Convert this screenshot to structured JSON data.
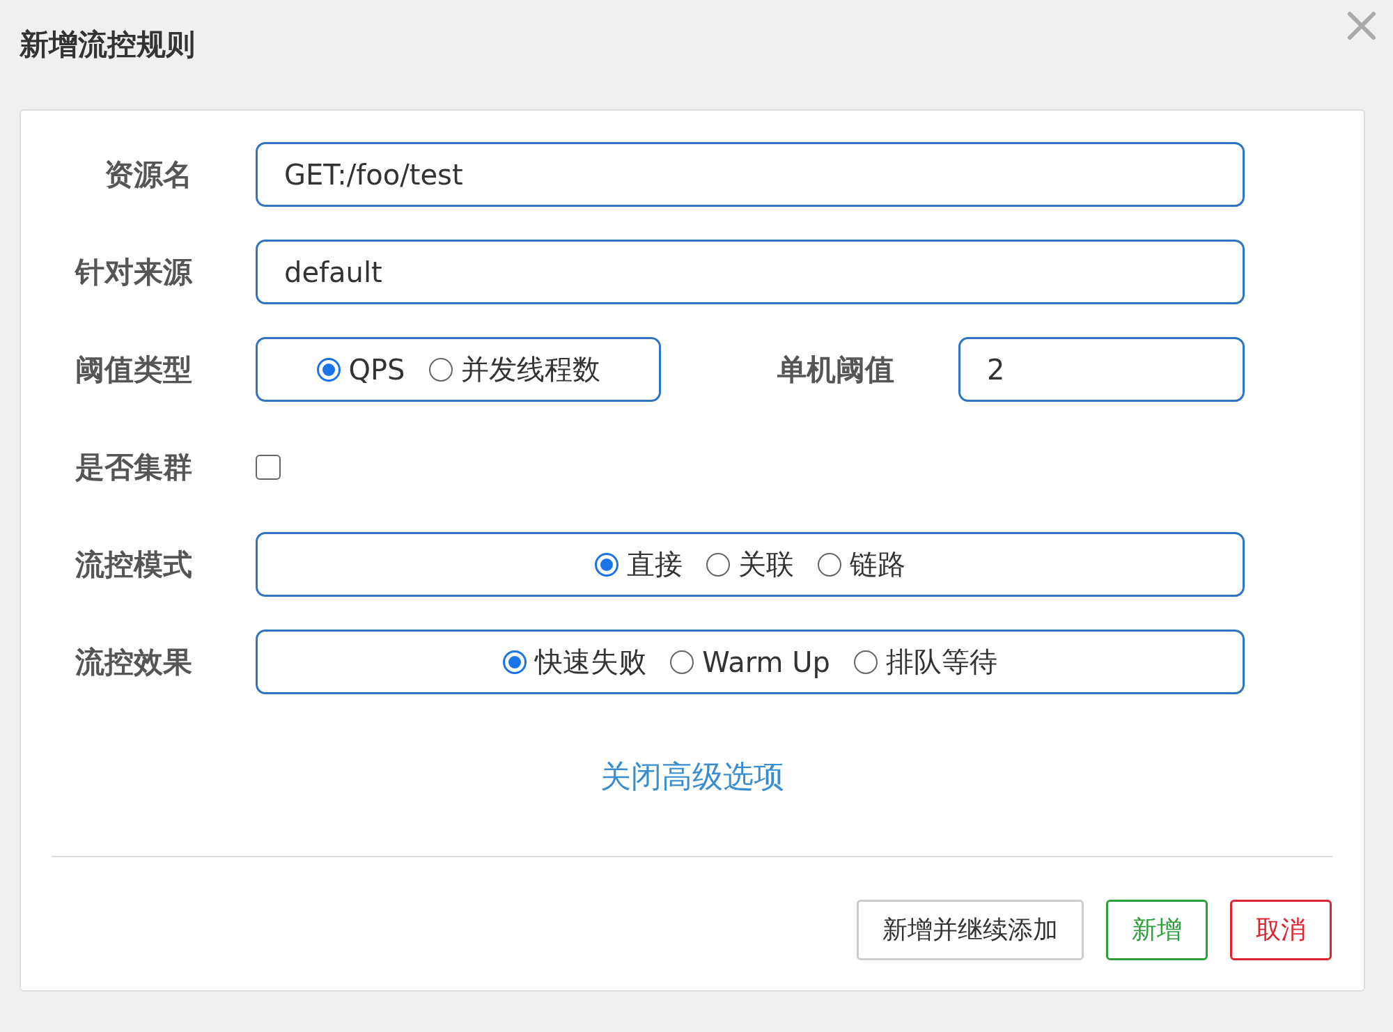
{
  "dialog": {
    "title": "新增流控规则"
  },
  "fields": [
    {
      "kind": "text",
      "label": "资源名",
      "value": "GET:/foo/test"
    },
    {
      "kind": "text",
      "label": "针对来源",
      "value": "default"
    },
    {
      "kind": "radio_with_input",
      "label": "阈值类型",
      "options": [
        {
          "label": "QPS",
          "selected": true
        },
        {
          "label": "并发线程数",
          "selected": false
        }
      ],
      "side_label": "单机阈值",
      "side_value": "2"
    },
    {
      "kind": "checkbox",
      "label": "是否集群",
      "checked": false
    },
    {
      "kind": "radio",
      "label": "流控模式",
      "options": [
        {
          "label": "直接",
          "selected": true
        },
        {
          "label": "关联",
          "selected": false
        },
        {
          "label": "链路",
          "selected": false
        }
      ]
    },
    {
      "kind": "radio",
      "label": "流控效果",
      "options": [
        {
          "label": "快速失败",
          "selected": true
        },
        {
          "label": "Warm Up",
          "selected": false
        },
        {
          "label": "排队等待",
          "selected": false
        }
      ]
    }
  ],
  "toggle_link": "关闭高级选项",
  "buttons": [
    {
      "label": "新增并继续添加",
      "kind": "default"
    },
    {
      "label": "新增",
      "kind": "success"
    },
    {
      "label": "取消",
      "kind": "danger"
    }
  ]
}
